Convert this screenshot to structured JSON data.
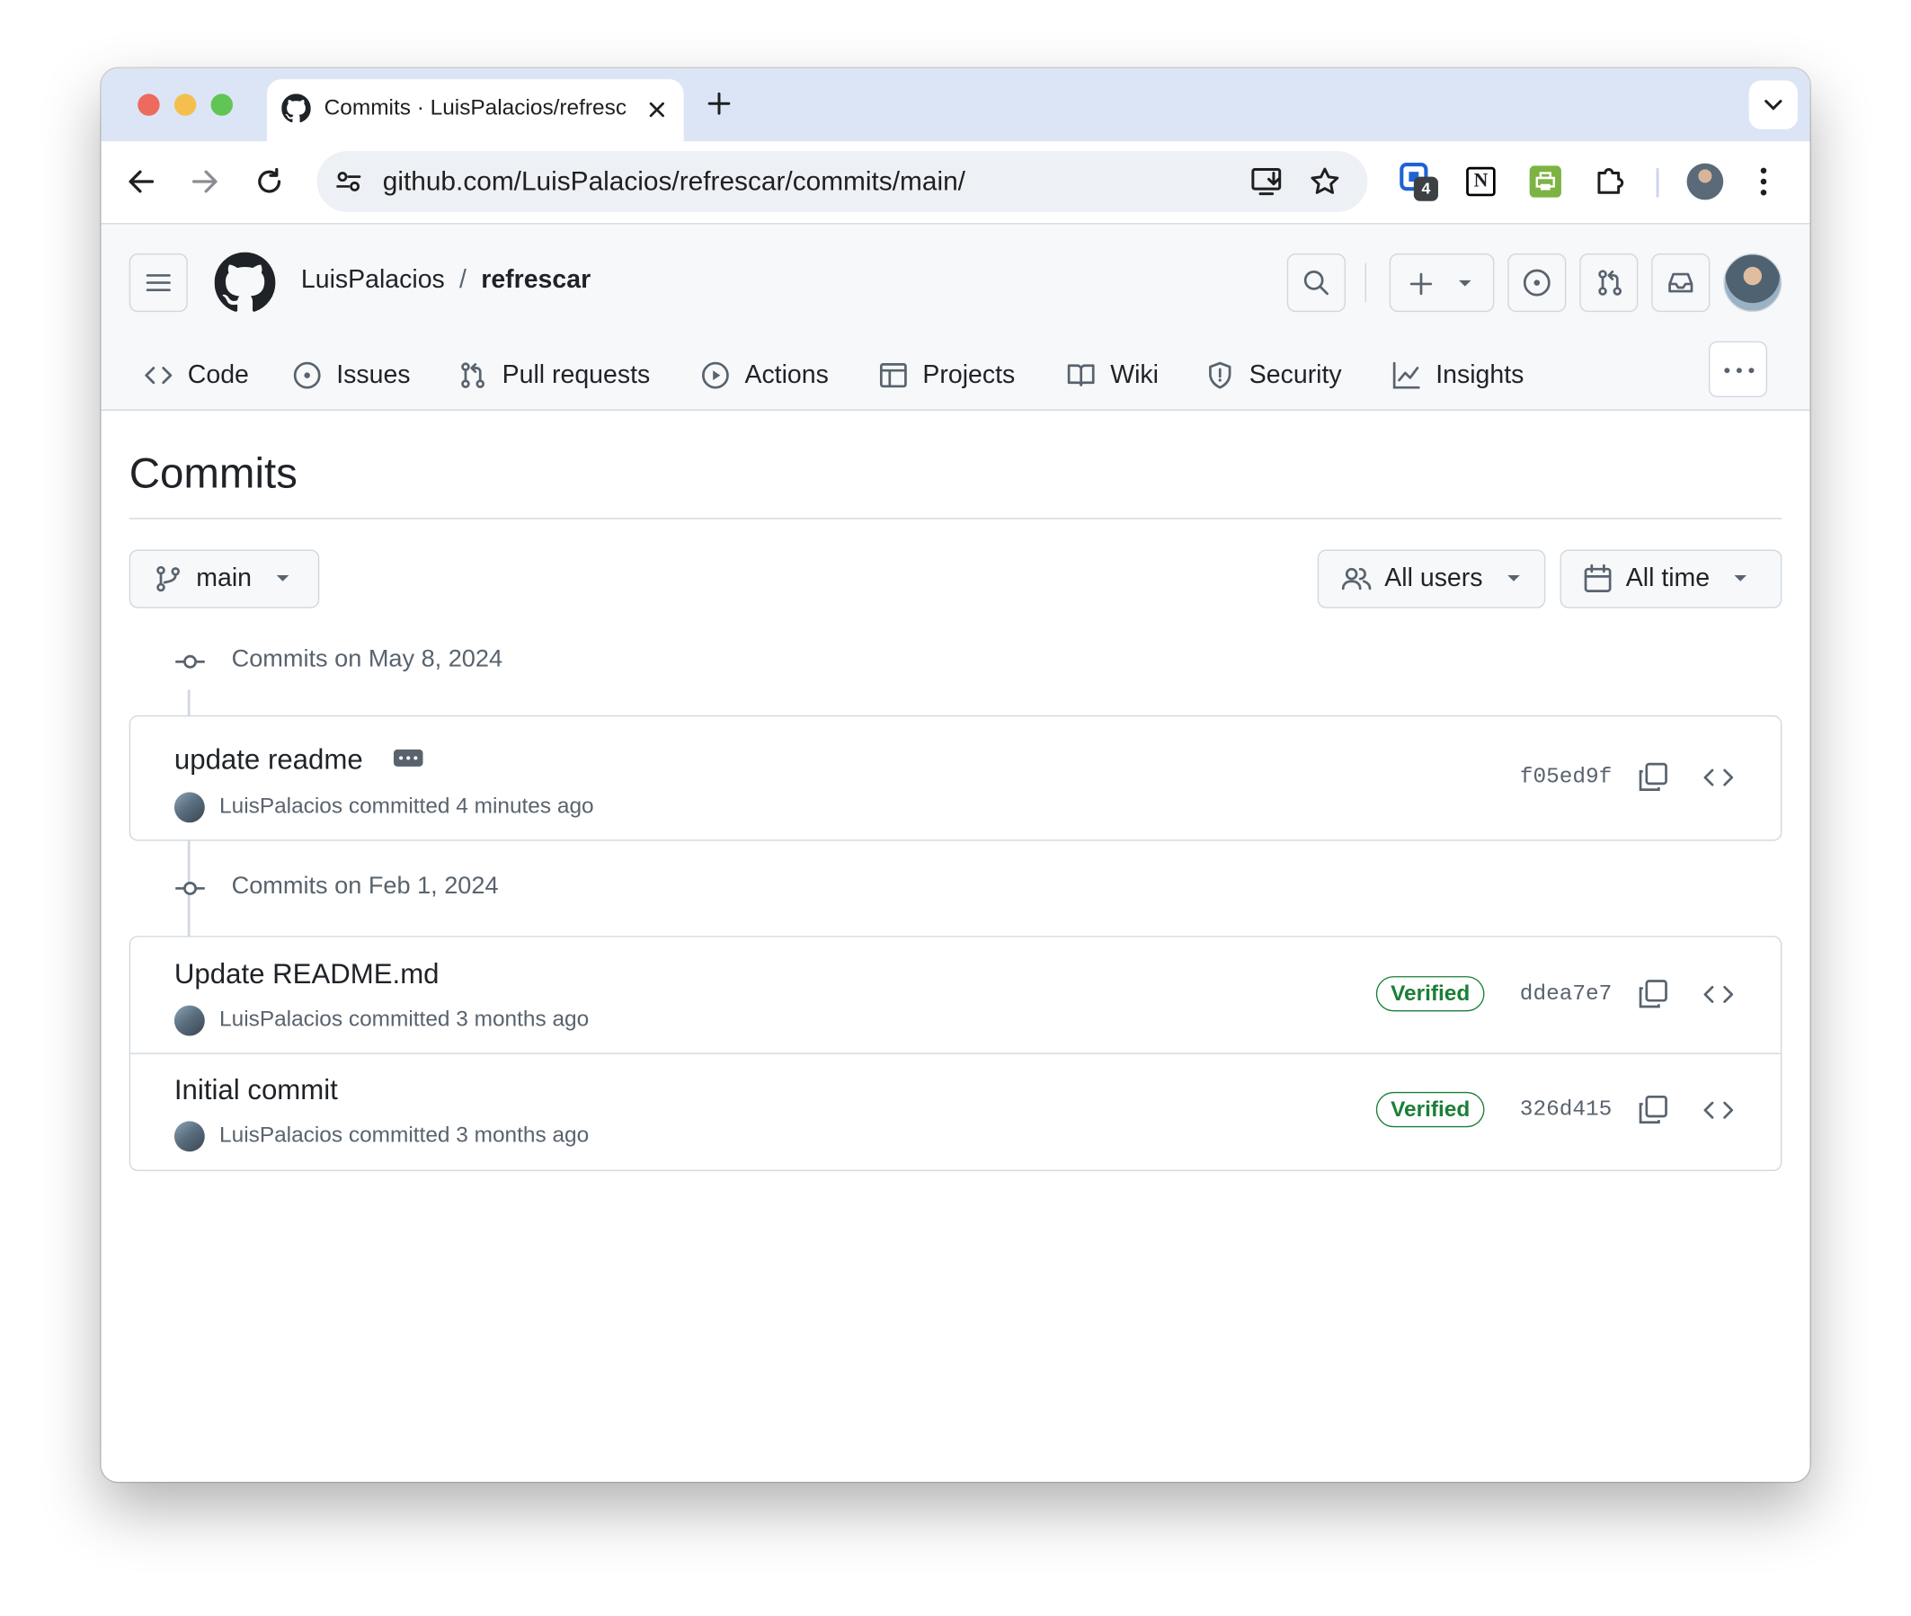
{
  "browser": {
    "tab_title": "Commits · LuisPalacios/refrescar",
    "url": "github.com/LuisPalacios/refrescar/commits/main/",
    "extension_badge": "4",
    "traffic_light_colors": [
      "#ed6a5e",
      "#f5bf4f",
      "#61c554"
    ]
  },
  "repo": {
    "owner": "LuisPalacios",
    "separator": "/",
    "name": "refrescar"
  },
  "nav": {
    "items": [
      {
        "label": "Code",
        "icon": "code-icon"
      },
      {
        "label": "Issues",
        "icon": "issue-icon"
      },
      {
        "label": "Pull requests",
        "icon": "pull-request-icon"
      },
      {
        "label": "Actions",
        "icon": "play-icon"
      },
      {
        "label": "Projects",
        "icon": "table-icon"
      },
      {
        "label": "Wiki",
        "icon": "book-icon"
      },
      {
        "label": "Security",
        "icon": "shield-icon"
      },
      {
        "label": "Insights",
        "icon": "graph-icon"
      }
    ]
  },
  "page": {
    "title": "Commits"
  },
  "filters": {
    "branch": "main",
    "users": "All users",
    "time": "All time"
  },
  "groups": [
    {
      "date_label": "Commits on May 8, 2024",
      "commits": [
        {
          "message": "update readme",
          "author": "LuisPalacios",
          "action": "committed",
          "time": "4 minutes ago",
          "sha": "f05ed9f",
          "verified": null
        }
      ]
    },
    {
      "date_label": "Commits on Feb 1, 2024",
      "commits": [
        {
          "message": "Update README.md",
          "author": "LuisPalacios",
          "action": "committed",
          "time": "3 months ago",
          "sha": "ddea7e7",
          "verified": "Verified"
        },
        {
          "message": "Initial commit",
          "author": "LuisPalacios",
          "action": "committed",
          "time": "3 months ago",
          "sha": "326d415",
          "verified": "Verified"
        }
      ]
    }
  ],
  "colors": {
    "verified_green": "#1a7f37",
    "muted_text": "#59636e",
    "border": "#d0d7de"
  }
}
